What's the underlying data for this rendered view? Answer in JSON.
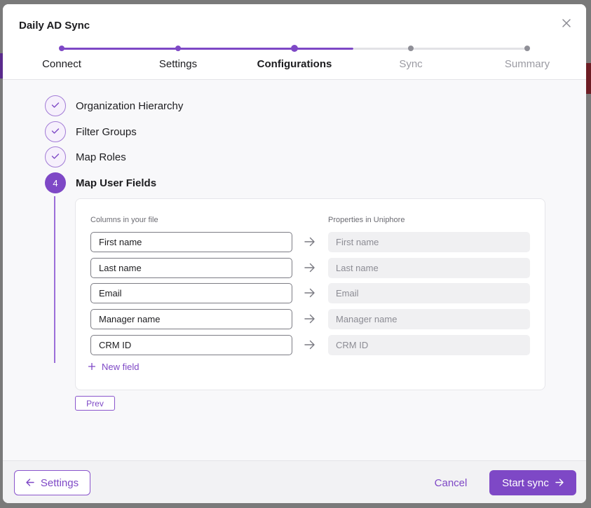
{
  "dialog": {
    "title": "Daily AD Sync"
  },
  "colors": {
    "accent": "#7e48c6",
    "step_inactive": "#8f8f97",
    "track_inactive": "#e2e2e6"
  },
  "steps": [
    {
      "label": "Connect",
      "state": "completed"
    },
    {
      "label": "Settings",
      "state": "completed"
    },
    {
      "label": "Configurations",
      "state": "active"
    },
    {
      "label": "Sync",
      "state": "upcoming"
    },
    {
      "label": "Summary",
      "state": "upcoming"
    }
  ],
  "substeps": [
    {
      "label": "Organization Hierarchy",
      "state": "done",
      "icon": "check-icon"
    },
    {
      "label": "Filter Groups",
      "state": "done",
      "icon": "check-icon"
    },
    {
      "label": "Map Roles",
      "state": "done",
      "icon": "check-icon"
    },
    {
      "number": "4",
      "label": "Map User Fields",
      "state": "active"
    }
  ],
  "mapping": {
    "columns_header": "Columns in your file",
    "properties_header": "Properties in Uniphore",
    "rows": [
      {
        "column": "First name",
        "property": "First name"
      },
      {
        "column": "Last name",
        "property": "Last name"
      },
      {
        "column": "Email",
        "property": "Email"
      },
      {
        "column": "Manager name",
        "property": "Manager name"
      },
      {
        "column": "CRM ID",
        "property": "CRM ID"
      }
    ],
    "new_field_label": "New field"
  },
  "prev_label": "Prev",
  "footer": {
    "back_label": "Settings",
    "cancel_label": "Cancel",
    "start_label": "Start sync"
  }
}
